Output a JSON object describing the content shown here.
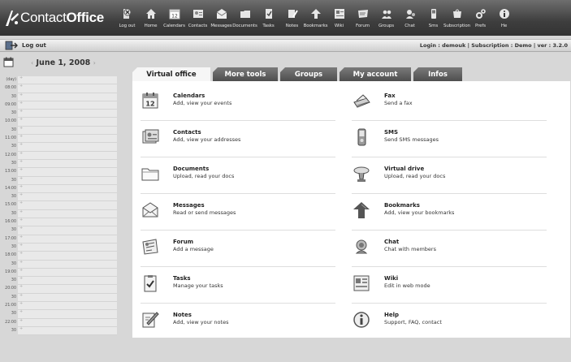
{
  "app": {
    "logo_prefix": "Contact",
    "logo_suffix": "Office",
    "toolbar": [
      {
        "label": "Log out",
        "icon": "logout-icon"
      },
      {
        "label": "Home",
        "icon": "home-icon"
      },
      {
        "label": "Calendars",
        "icon": "calendar-icon"
      },
      {
        "label": "Contacts",
        "icon": "contacts-icon"
      },
      {
        "label": "Messages",
        "icon": "messages-icon"
      },
      {
        "label": "Documents",
        "icon": "documents-icon"
      },
      {
        "label": "Tasks",
        "icon": "tasks-icon"
      },
      {
        "label": "Notes",
        "icon": "notes-icon"
      },
      {
        "label": "Bookmarks",
        "icon": "bookmarks-icon"
      },
      {
        "label": "Wiki",
        "icon": "wiki-icon"
      },
      {
        "label": "Forum",
        "icon": "forum-icon"
      },
      {
        "label": "Groups",
        "icon": "groups-icon"
      },
      {
        "label": "Chat",
        "icon": "chat-icon"
      },
      {
        "label": "Sms",
        "icon": "sms-icon"
      },
      {
        "label": "Subscription",
        "icon": "subscription-icon"
      },
      {
        "label": "Prefs",
        "icon": "prefs-icon"
      },
      {
        "label": "He",
        "icon": "help-icon"
      }
    ]
  },
  "subbar": {
    "logout_label": "Log out",
    "info": "Login : demouk | Subscription : Demo | ver : 3.2.0"
  },
  "calendar": {
    "prev": "‹",
    "date": "June 1, 2008",
    "next": "›",
    "day_label": "(day)",
    "times": [
      "08:00",
      "30",
      "09:00",
      "30",
      "10:00",
      "30",
      "11:00",
      "30",
      "12:00",
      "30",
      "13:00",
      "30",
      "14:00",
      "30",
      "15:00",
      "30",
      "16:00",
      "30",
      "17:00",
      "30",
      "18:00",
      "30",
      "19:00",
      "30",
      "20:00",
      "30",
      "21:00",
      "30",
      "22:00",
      "30"
    ]
  },
  "tabs": [
    "Virtual office",
    "More tools",
    "Groups",
    "My account",
    "Infos"
  ],
  "features": [
    {
      "name": "Calendars",
      "desc": "Add, view your events",
      "icon": "calendar-icon"
    },
    {
      "name": "Fax",
      "desc": "Send a fax",
      "icon": "fax-icon"
    },
    {
      "name": "Contacts",
      "desc": "Add, view your addresses",
      "icon": "contacts-icon"
    },
    {
      "name": "SMS",
      "desc": "Send SMS messages",
      "icon": "sms-icon"
    },
    {
      "name": "Documents",
      "desc": "Upload, read your docs",
      "icon": "folder-icon"
    },
    {
      "name": "Virtual drive",
      "desc": "Upload, read your docs",
      "icon": "drive-icon"
    },
    {
      "name": "Messages",
      "desc": "Read or send messages",
      "icon": "envelope-icon"
    },
    {
      "name": "Bookmarks",
      "desc": "Add, view your bookmarks",
      "icon": "bookmarks-icon"
    },
    {
      "name": "Forum",
      "desc": "Add a message",
      "icon": "forum-icon"
    },
    {
      "name": "Chat",
      "desc": "Chat with members",
      "icon": "chat-icon"
    },
    {
      "name": "Tasks",
      "desc": "Manage your tasks",
      "icon": "tasks-icon"
    },
    {
      "name": "Wiki",
      "desc": "Edit in web mode",
      "icon": "wiki-icon"
    },
    {
      "name": "Notes",
      "desc": "Add, view your notes",
      "icon": "notes-icon"
    },
    {
      "name": "Help",
      "desc": "Support, FAQ, contact",
      "icon": "help-icon"
    }
  ],
  "colors": {
    "toolbar": "#3e3e3e",
    "tab_inactive": "#5e5e5e",
    "tab_active": "#f6f6f6",
    "slot": "#e9e9e9"
  }
}
